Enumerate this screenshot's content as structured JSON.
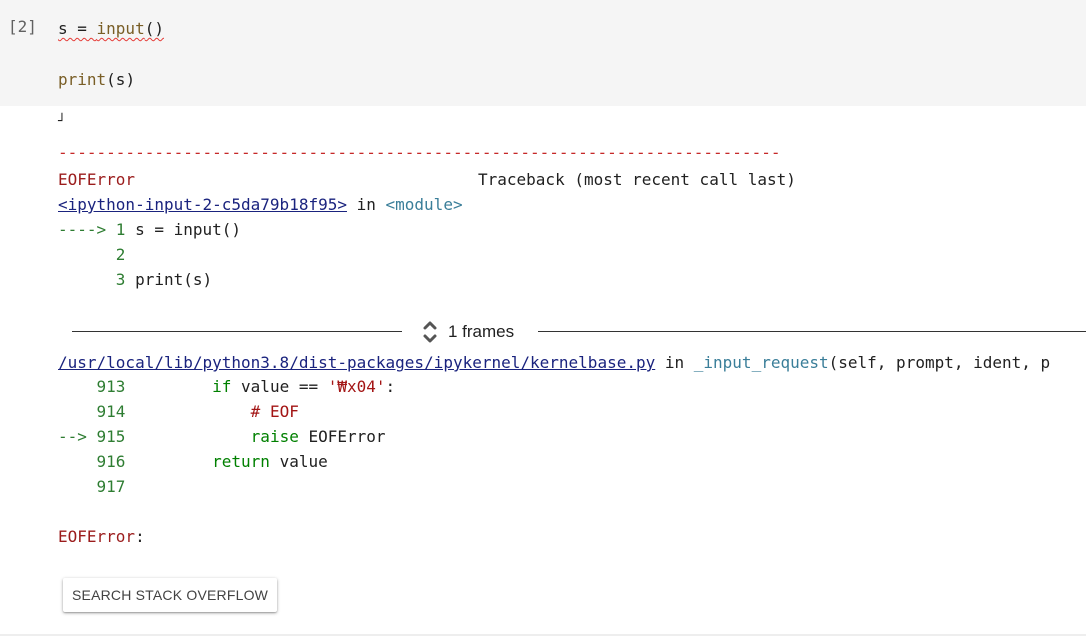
{
  "cell": {
    "exec_count": "[2]",
    "code": {
      "line1_var": "s = ",
      "line1_fn": "input",
      "line1_paren": "()",
      "line3_fn": "print",
      "line3_args": "(s)"
    }
  },
  "output": {
    "stdin_cursor": "┘",
    "separator": "---------------------------------------------------------------------------",
    "error_name": "EOFError",
    "traceback_label": "Traceback (most recent call last)",
    "input_link": "<ipython-input-2-c5da79b18f95>",
    "in_word": " in ",
    "module": "<module>",
    "frame1": [
      {
        "arrow": "----> ",
        "num": "1",
        "code": " s = input()"
      },
      {
        "arrow": "      ",
        "num": "2",
        "code": ""
      },
      {
        "arrow": "      ",
        "num": "3",
        "code": " print(s)"
      }
    ],
    "frames_label": "1 frames",
    "file_link": "/usr/local/lib/python3.8/dist-packages/ipykernel/kernelbase.py",
    "func_name": "_input_request",
    "func_args": "(self, prompt, ident, p",
    "frame2": {
      "l913_num": "913",
      "l913_if": "if",
      "l913_mid": " value == ",
      "l913_str": "'₩x04'",
      "l913_end": ":",
      "l914_num": "914",
      "l914_comment": "# EOF",
      "l915_arrow": "--> ",
      "l915_num": "915",
      "l915_raise": "raise",
      "l915_exc": " EOFError",
      "l916_num": "916",
      "l916_return": "return",
      "l916_val": " value",
      "l917_num": "917"
    },
    "final_error": "EOFError",
    "final_colon": ":"
  },
  "actions": {
    "search_stack_overflow": "SEARCH STACK OVERFLOW"
  }
}
